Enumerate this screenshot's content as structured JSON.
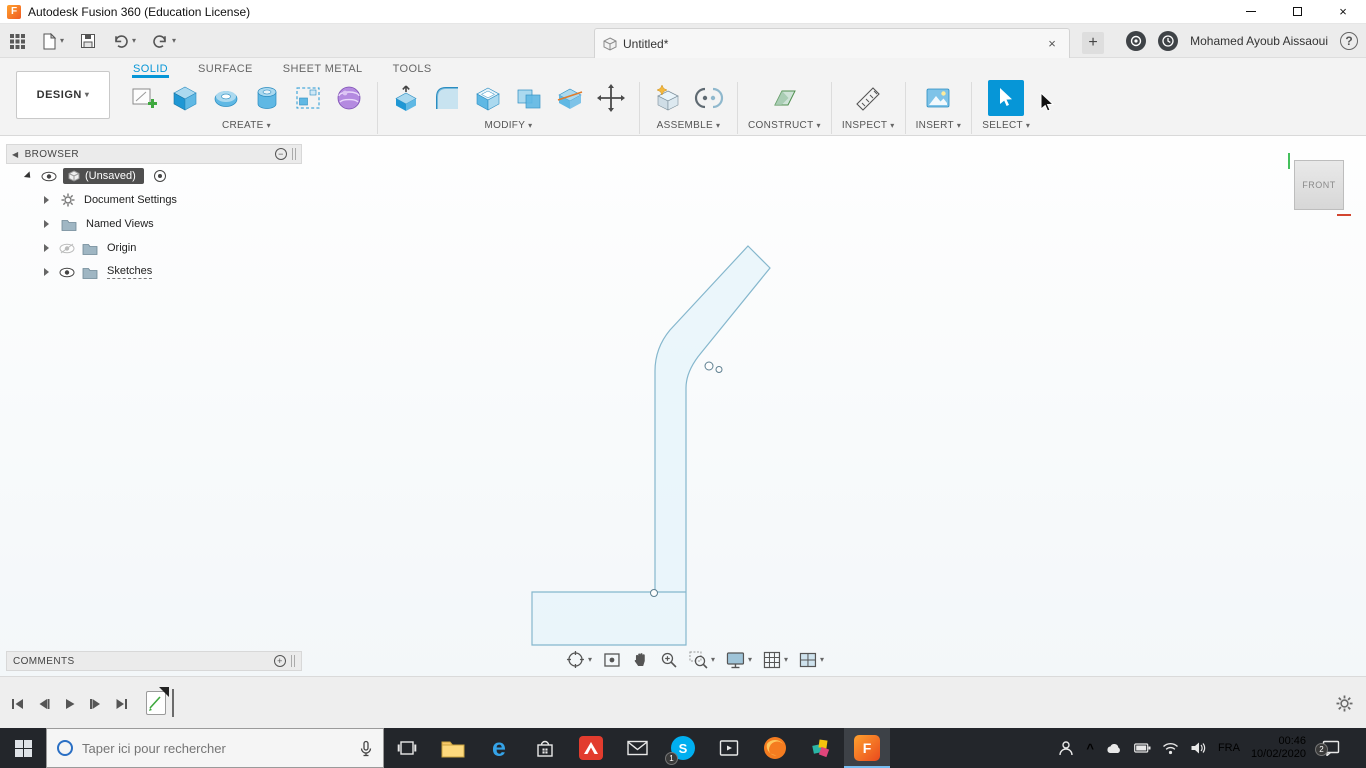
{
  "glyphs": {
    "caret": "▾",
    "close": "×",
    "help": "?",
    "plus": "+",
    "minus": "−",
    "chevron_up": "^",
    "collapse_left": "◀"
  },
  "title_bar": {
    "icon_letter": "F",
    "title": "Autodesk Fusion 360 (Education License)"
  },
  "app_bar": {
    "doc_tab": "Untitled*",
    "user_name": "Mohamed Ayoub Aissaoui"
  },
  "workspace": {
    "label": "DESIGN"
  },
  "ribbon": {
    "tabs": [
      {
        "label": "SOLID"
      },
      {
        "label": "SURFACE"
      },
      {
        "label": "SHEET METAL"
      },
      {
        "label": "TOOLS"
      }
    ],
    "groups": {
      "create": "CREATE",
      "modify": "MODIFY",
      "assemble": "ASSEMBLE",
      "construct": "CONSTRUCT",
      "inspect": "INSPECT",
      "insert": "INSERT",
      "select": "SELECT"
    }
  },
  "browser": {
    "header": "BROWSER",
    "root_label": "(Unsaved)",
    "items": [
      {
        "label": "Document Settings"
      },
      {
        "label": "Named Views"
      },
      {
        "label": "Origin"
      },
      {
        "label": "Sketches"
      }
    ]
  },
  "viewcube": {
    "face": "FRONT"
  },
  "comments": {
    "header": "COMMENTS"
  },
  "taskbar": {
    "search_placeholder": "Taper ici pour rechercher",
    "language": "FRA",
    "time": "00:46",
    "date": "10/02/2020",
    "skype_badge": "1",
    "notification_badge": "2",
    "letters": {
      "edge": "e",
      "skype": "S",
      "fusion": "F"
    }
  },
  "colors": {
    "accent": "#0696d7",
    "fusion_orange": "#ef5a22",
    "sketch_stroke": "#85b7cd",
    "sketch_fill": "#e8f4fa"
  }
}
